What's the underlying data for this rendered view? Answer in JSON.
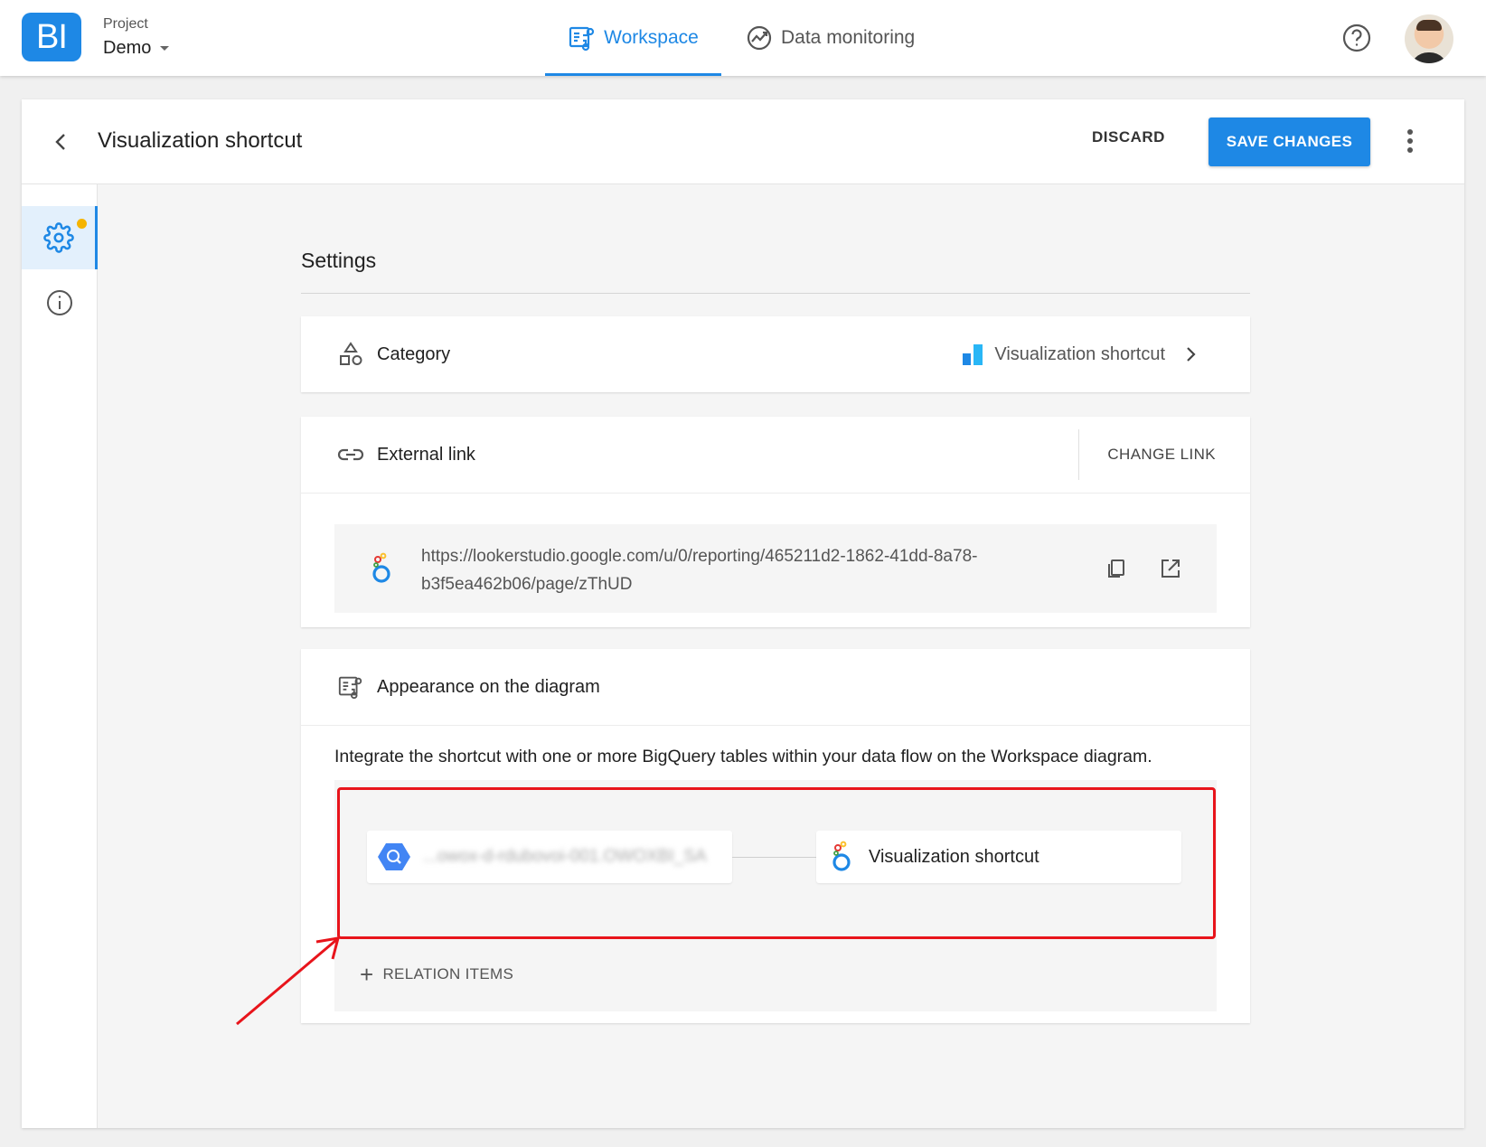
{
  "header": {
    "logo_text": "BI",
    "project_label": "Project",
    "project_name": "Demo",
    "tabs": [
      {
        "label": "Workspace",
        "active": true
      },
      {
        "label": "Data monitoring",
        "active": false
      }
    ]
  },
  "page": {
    "title": "Visualization shortcut",
    "discard_label": "DISCARD",
    "save_label": "SAVE CHANGES"
  },
  "content": {
    "section_title": "Settings",
    "category": {
      "label": "Category",
      "value": "Visualization shortcut"
    },
    "external_link": {
      "label": "External link",
      "change_label": "CHANGE LINK",
      "url_line1": "https://lookerstudio.google.com/u/0/reporting/465211d2-1862-41dd-8a78-",
      "url_line2": "b3f5ea462b06/page/zThUD"
    },
    "appearance": {
      "label": "Appearance on the diagram",
      "description": "Integrate the shortcut with one or more BigQuery tables within your data flow on the Workspace diagram.",
      "source_node": "...owox-d-rdubovoi-001.OWOXBI_SA",
      "target_node": "Visualization shortcut",
      "relation_label": "RELATION ITEMS"
    }
  },
  "colors": {
    "accent": "#1e88e5",
    "highlight": "#e8141b",
    "badge": "#f5b400"
  }
}
